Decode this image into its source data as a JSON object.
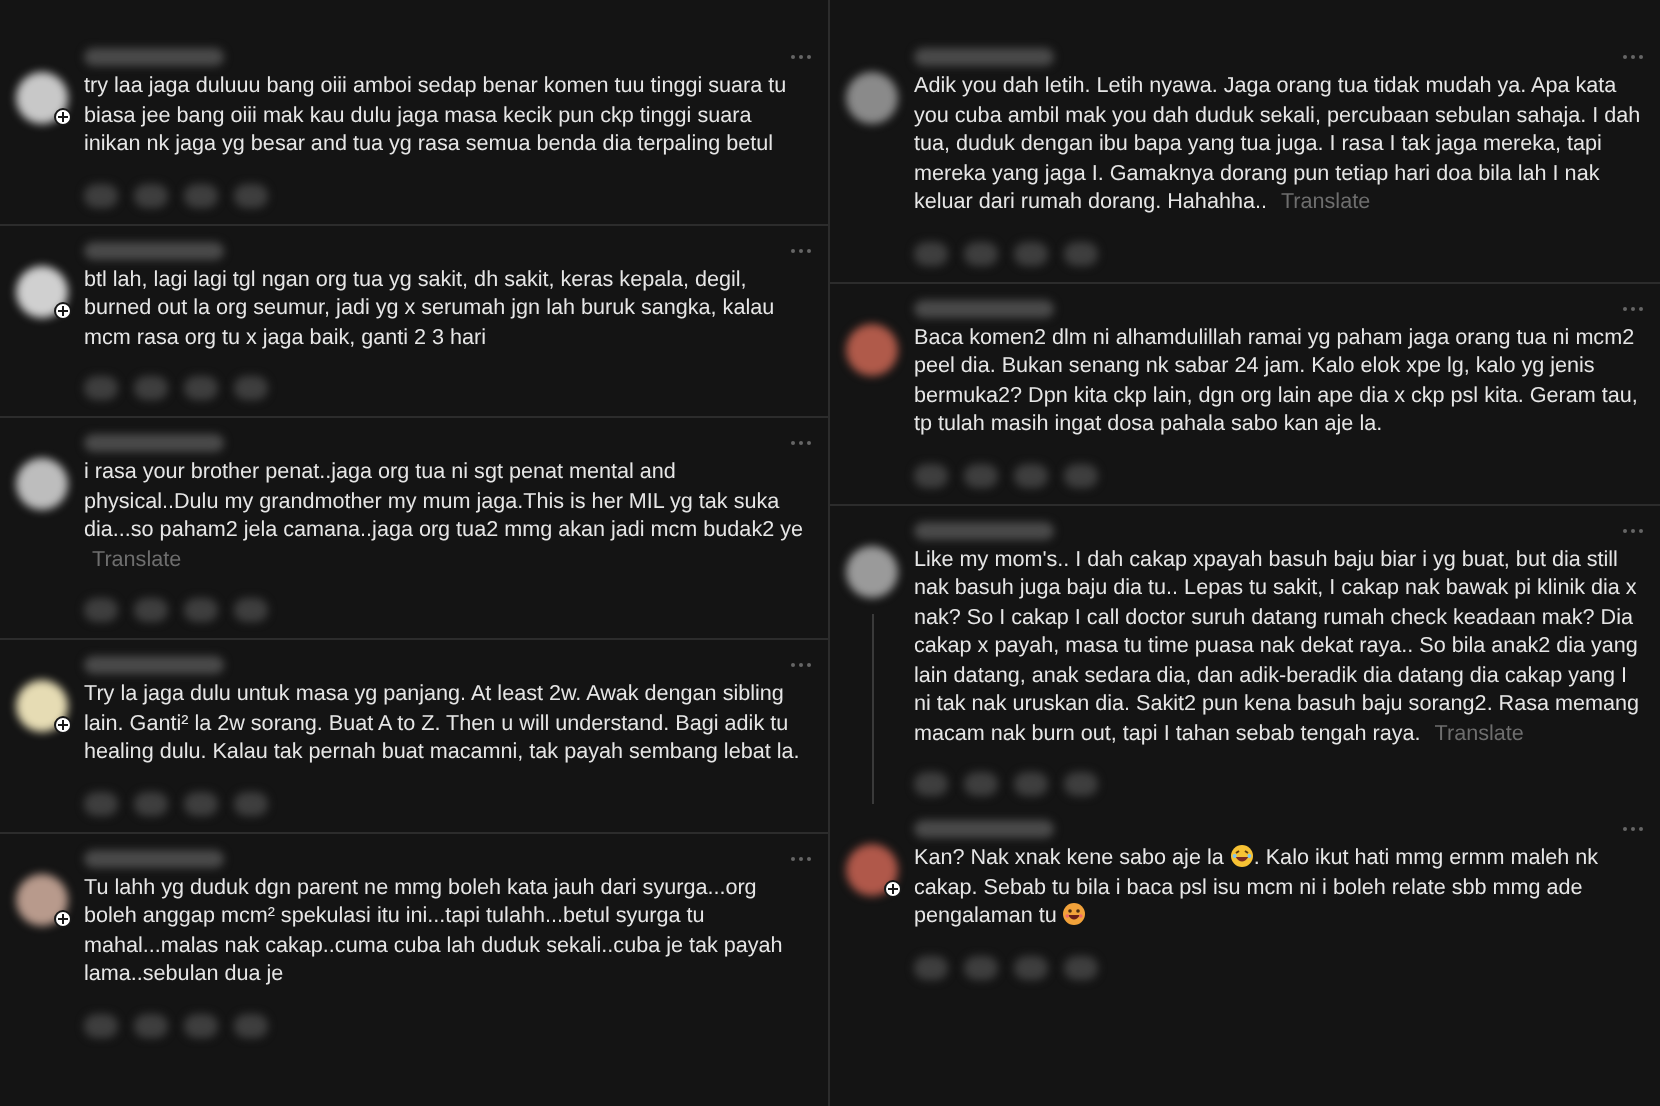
{
  "columns": [
    {
      "comments": [
        {
          "color": "#c8c8c8",
          "badge": true,
          "body": [
            {
              "kind": "text",
              "text": "try laa jaga duluuu bang oiii amboi sedap benar komen tuu tinggi suara tu biasa jee bang oiii mak kau dulu jaga masa kecik pun ckp tinggi suara inikan nk jaga yg besar and tua yg rasa semua benda dia terpaling betul"
            }
          ]
        },
        {
          "color": "#d0d0d0",
          "badge": true,
          "body": [
            {
              "kind": "text",
              "text": "btl lah, lagi lagi tgl ngan org tua yg sakit, dh sakit, keras kepala, degil, burned out la org seumur, jadi yg x serumah jgn lah buruk sangka, kalau mcm rasa org tu x jaga baik, ganti 2 3 hari"
            }
          ]
        },
        {
          "color": "#bdbdbd",
          "badge": false,
          "body": [
            {
              "kind": "text",
              "text": "i rasa your brother penat..jaga org tua ni sgt penat mental and physical..Dulu my grandmother my mum jaga.This is her MIL yg tak suka dia...so paham2 jela camana..jaga org tua2 mmg akan jadi mcm budak2 ye"
            }
          ],
          "translate": "Translate"
        },
        {
          "color": "#e6dcb4",
          "badge": true,
          "body": [
            {
              "kind": "text",
              "text": "Try la jaga dulu untuk masa yg panjang. At least 2w. Awak dengan sibling lain. Ganti² la 2w sorang. Buat A to Z. Then u will understand. Bagi adik tu healing dulu. Kalau tak pernah buat macamni, tak payah sembang lebat la."
            }
          ]
        },
        {
          "color": "#b89a8c",
          "badge": true,
          "body": [
            {
              "kind": "text",
              "text": "Tu lahh yg duduk dgn parent ne mmg boleh kata jauh dari syurga...org boleh anggap mcm² spekulasi itu ini...tapi tulahh...betul syurga tu mahal...malas nak cakap..cuma cuba lah duduk sekali..cuba je tak payah lama..sebulan dua je"
            }
          ]
        }
      ]
    },
    {
      "comments": [
        {
          "color": "#8a8a8a",
          "badge": false,
          "body": [
            {
              "kind": "text",
              "text": "Adik you dah letih. Letih nyawa. Jaga orang tua tidak mudah ya. Apa kata you cuba ambil mak you dah duduk sekali, percubaan sebulan sahaja. I dah tua, duduk dengan ibu bapa yang tua juga. I rasa I tak jaga mereka, tapi mereka yang jaga I. Gamaknya dorang pun tetiap hari doa bila lah I nak keluar dari rumah dorang. Hahahha.."
            }
          ],
          "translate": "Translate"
        },
        {
          "color": "#b05a4a",
          "badge": false,
          "body": [
            {
              "kind": "text",
              "text": "Baca komen2 dlm ni alhamdulillah ramai yg paham jaga orang tua ni mcm2 peel dia. Bukan senang nk sabar 24 jam. Kalo elok xpe lg, kalo yg jenis bermuka2? Dpn kita ckp lain, dgn org lain ape dia x ckp psl kita. Geram tau, tp tulah masih ingat dosa pahala sabo kan aje la."
            }
          ]
        },
        {
          "color": "#9a9a9a",
          "badge": false,
          "body": [
            {
              "kind": "text",
              "text": "Like my mom's.. I dah cakap xpayah basuh baju biar i yg buat, but dia still nak basuh juga baju dia tu.. Lepas tu sakit, I cakap nak bawak pi klinik dia x nak? So I cakap I call doctor suruh datang rumah check keadaan mak? Dia cakap x payah, masa tu time puasa nak dekat raya.. So bila anak2 dia yang lain datang, anak sedara dia, dan adik-beradik dia datang dia cakap yang I ni tak nak uruskan dia. Sakit2 pun kena basuh baju sorang2. Rasa memang macam nak burn out, tapi I tahan sebab tengah raya."
            }
          ],
          "translate": "Translate",
          "replies": [
            {
              "color": "#b0584a",
              "badge": true,
              "body": [
                {
                  "kind": "text",
                  "text": "Kan? Nak xnak kene sabo aje la "
                },
                {
                  "kind": "laughing"
                },
                {
                  "kind": "text",
                  "text": ". Kalo ikut hati mmg ermm maleh nk cakap. Sebab tu bila i baca psl isu mcm ni i boleh relate sbb mmg ade pengalaman tu "
                },
                {
                  "kind": "grinning"
                }
              ]
            }
          ]
        }
      ]
    }
  ]
}
